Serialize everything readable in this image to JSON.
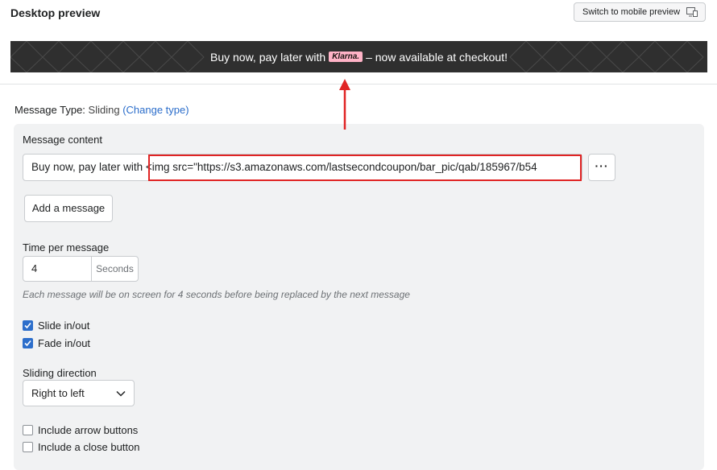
{
  "header": {
    "title": "Desktop preview",
    "mobile_button": "Switch to mobile preview"
  },
  "preview_bar": {
    "text_before": "Buy now, pay later with",
    "logo": "Klarna.",
    "text_after": "– now available at checkout!"
  },
  "message_type": {
    "label": "Message Type:",
    "value": "Sliding",
    "change_link": "(Change type)"
  },
  "message_content": {
    "label": "Message content",
    "value": "Buy now, pay later with <img src=\"https://s3.amazonaws.com/lastsecondcoupon/bar_pic/qab/185967/b54",
    "more_button": "···",
    "add_button": "Add a message"
  },
  "time_per_message": {
    "label": "Time per message",
    "value": "4",
    "unit": "Seconds",
    "help": "Each message will be on screen for 4 seconds before being replaced by the next message"
  },
  "options": [
    {
      "label": "Slide in/out",
      "checked": true
    },
    {
      "label": "Fade in/out",
      "checked": true
    }
  ],
  "sliding_direction": {
    "label": "Sliding direction",
    "value": "Right to left"
  },
  "extra_options": [
    {
      "label": "Include arrow buttons",
      "checked": false
    },
    {
      "label": "Include a close button",
      "checked": false
    }
  ],
  "colors": {
    "accent": "#2c6ecb",
    "annotation": "#e02424",
    "bar_bg": "#2f2f2f",
    "klarna_pink": "#ffb3c7"
  }
}
